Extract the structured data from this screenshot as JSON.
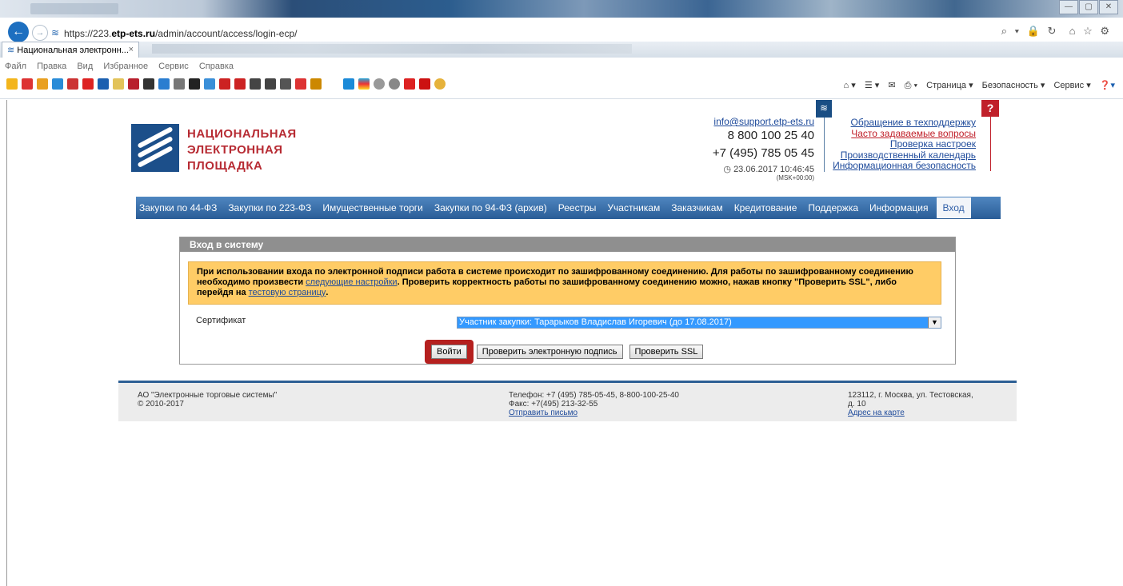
{
  "browser": {
    "url_prefix": "https://223.",
    "url_domain": "etp-ets.ru",
    "url_path": "/admin/account/access/login-ecp/",
    "search_controls": "⌕ ▾ 🔒 ↻",
    "home_star_gear": "⌂ ☆ ⚙",
    "tab_title": "Национальная электронн...",
    "tab_close": "×",
    "menu": [
      "Файл",
      "Правка",
      "Вид",
      "Избранное",
      "Сервис",
      "Справка"
    ],
    "toolbar": {
      "page": "Страница ▾",
      "security": "Безопасность ▾",
      "service": "Сервис ▾"
    },
    "window_buttons": [
      "—",
      "▢",
      "✕"
    ]
  },
  "header": {
    "brand_line1": "НАЦИОНАЛЬНАЯ",
    "brand_line2": "ЭЛЕКТРОННАЯ",
    "brand_line3": "ПЛОЩАДКА",
    "email": "info@support.etp-ets.ru",
    "phone1": "8 800 100 25 40",
    "phone2": "+7 (495) 785 05 45",
    "datetime": "23.06.2017 10:46:45",
    "timezone": "(MSK+00:00)",
    "links": [
      "Обращение в техподдержку",
      "Часто задаваемые вопросы",
      "Проверка настроек",
      "Производственный календарь",
      "Информационная безопасность"
    ],
    "help_flag": "?"
  },
  "nav": {
    "items": [
      "Закупки по 44-ФЗ",
      "Закупки по 223-ФЗ",
      "Имущественные торги",
      "Закупки по 94-ФЗ (архив)",
      "Реестры",
      "Участникам",
      "Заказчикам",
      "Кредитование",
      "Поддержка",
      "Информация",
      "Вход"
    ]
  },
  "login": {
    "title": "Вход в систему",
    "notice_part1": "При использовании входа по электронной подписи работа в системе происходит по зашифрованному соединению. Для работы по зашифрованному соединению необходимо произвести ",
    "notice_link1": "следующие настройки",
    "notice_part2": ". Проверить корректность работы по зашифрованному соединению можно, нажав кнопку \"Проверить SSL\", либо перейдя на ",
    "notice_link2": "тестовую страницу",
    "notice_part3": ".",
    "cert_label": "Сертификат",
    "cert_value": "Участник закупки: Тарарыков Владислав Игоревич (до 17.08.2017)",
    "buttons": {
      "login": "Войти",
      "check_signature": "Проверить электронную подпись",
      "check_ssl": "Проверить SSL"
    }
  },
  "footer": {
    "company": "АО \"Электронные торговые системы\"",
    "copyright": "© 2010-2017",
    "phone": "Телефон: +7 (495) 785-05-45, 8-800-100-25-40",
    "fax": "Факс: +7(495) 213-32-55",
    "send_letter": "Отправить письмо",
    "address_line1": "123112, г. Москва, ул. Тестовская,",
    "address_line2": "д. 10",
    "map_link": "Адрес на карте"
  }
}
